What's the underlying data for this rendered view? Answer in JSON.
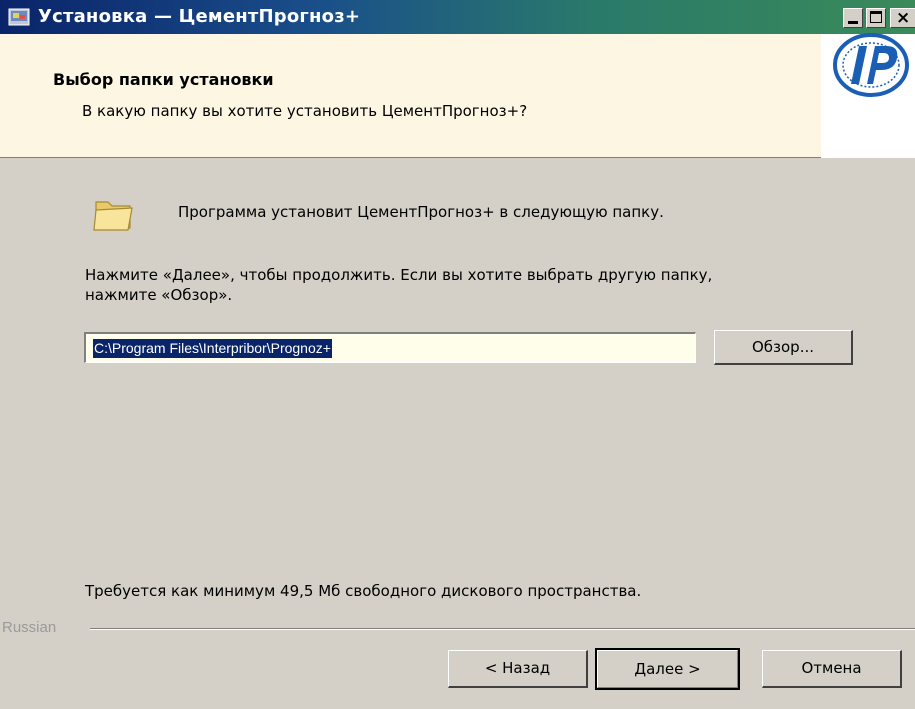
{
  "window": {
    "title": "Установка — ЦементПрогноз+"
  },
  "header": {
    "title": "Выбор папки установки",
    "subtitle": "В какую папку вы хотите установить ЦементПрогноз+?"
  },
  "body": {
    "folder_text": "Программа установит ЦементПрогноз+ в следующую папку.",
    "instructions_line1": "Нажмите «Далее», чтобы продолжить. Если вы хотите выбрать другую папку,",
    "instructions_line2": "нажмите «Обзор».",
    "path_value": "C:\\Program Files\\Interpribor\\Prognoz+",
    "browse_label": "Обзор...",
    "space_text": "Требуется как минимум 49,5 Мб свободного дискового пространства."
  },
  "footer": {
    "language": "Russian",
    "back_label": "< Назад",
    "next_label": "Далее >",
    "cancel_label": "Отмена"
  },
  "colors": {
    "title_gradient_start": "#0a246a",
    "title_gradient_end": "#3a8a5a",
    "header_bg": "#fdf6e2",
    "window_bg": "#d4d0c8",
    "selection_bg": "#0a246a",
    "logo_blue": "#1a5fb4"
  },
  "icons": {
    "title_icon": "installer-app-icon",
    "folder": "folder-icon",
    "logo": "interpribor-ip-logo"
  }
}
